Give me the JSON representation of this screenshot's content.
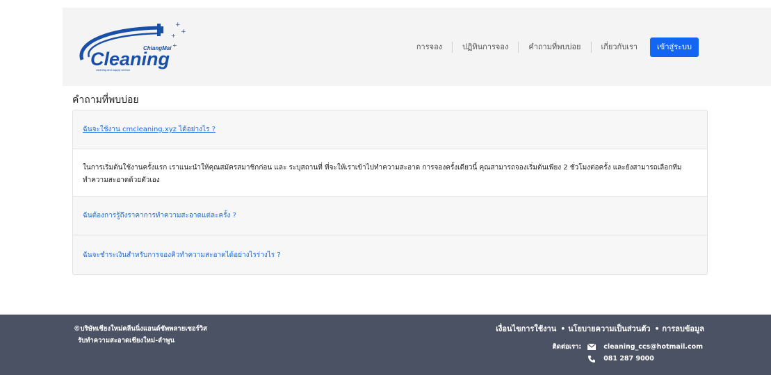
{
  "header": {
    "logo": {
      "brand_small": "ChiangMai",
      "brand_main": "Cleaning",
      "tagline": "cleaning and supply service"
    },
    "nav": [
      {
        "label": "การจอง"
      },
      {
        "label": "ปฏิทินการจอง"
      },
      {
        "label": "คำถามที่พบบ่อย"
      },
      {
        "label": "เกี่ยวกับเรา"
      }
    ],
    "login_label": "เข้าสู่ระบบ"
  },
  "main": {
    "title": "คำถามที่พบบ่อย",
    "faq": [
      {
        "question": "ฉันจะใช้งาน cmcleaning.xyz ได้อย่างไร ?",
        "answer": "ในการเริ่มต้นใช้งานครั้งแรก เราแนะนำให้คุณสมัครสมาชิกก่อน และ ระบุสถานที่ ที่จะให้เราเข้าไปทำความสะอาด การจองครั้งเดียวนี้ คุณสามารถจองเริ่มต้นเพียง 2 ชั่วโมงต่อครั้ง และยังสามารถเลือกทีมทำความสะอาดด้วยตัวเอง"
      },
      {
        "question": "ฉันต้องการรู้ถึงราคาการทำความสะอาดแต่ละครั้ง ?"
      },
      {
        "question": "ฉันจะชำระเงินสำหรับการจองคิวทำความสะอาดได้อย่างไรร่างไร ?"
      }
    ]
  },
  "footer": {
    "company_line1": "©บริษัทเชียงใหม่คลีนนิ่งแอนด์ซัพพลายเซอร์วิส",
    "company_line2": "รับทำความสะอาดเชียงใหม่-ลำพูน",
    "links": [
      "เงื่อนไขการใช้งาน",
      "• นโยบายความเป็นส่วนตัว",
      "• การลบข้อมูล"
    ],
    "contact_label": "ติดต่อเรา:",
    "email": "cleaning_ccs@hotmail.com",
    "phone": "081 287 9000"
  },
  "colors": {
    "accent": "#1266f1",
    "link": "#1a6de0",
    "footer_bg": "#4b5264",
    "logo_blue": "#1a4fa8"
  },
  "icons": [
    "mail-icon",
    "phone-icon"
  ]
}
